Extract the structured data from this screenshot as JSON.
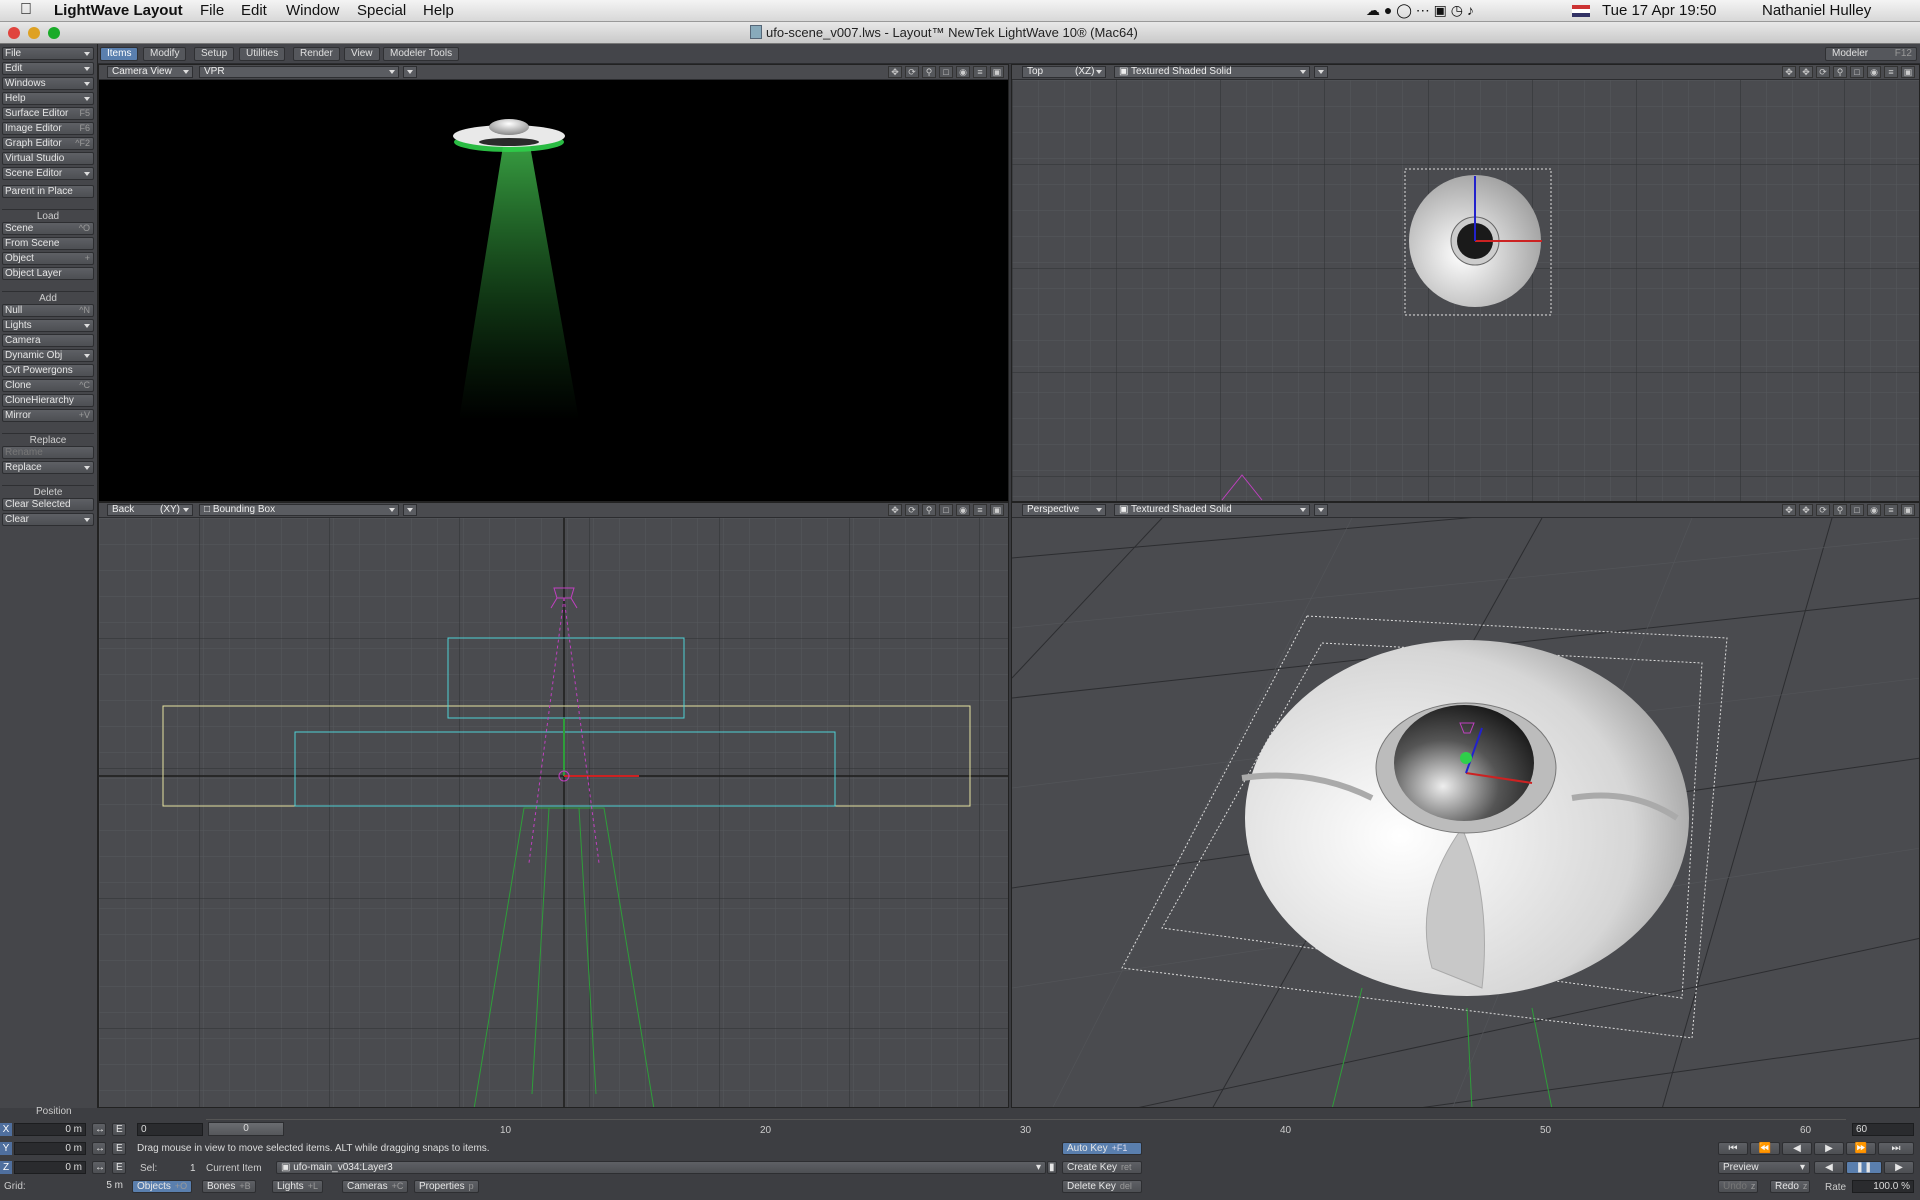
{
  "menubar": {
    "app_name": "LightWave Layout",
    "menus": [
      "File",
      "Edit",
      "Window",
      "Special",
      "Help"
    ],
    "clock": "Tue 17 Apr  19:50",
    "user": "Nathaniel Hulley"
  },
  "window": {
    "title": "ufo-scene_v007.lws - Layout™ NewTek LightWave 10® (Mac64)"
  },
  "tabs": [
    "Items",
    "Modify",
    "Setup",
    "Utilities",
    "Render",
    "View",
    "Modeler Tools"
  ],
  "modeler_button": {
    "label": "Modeler",
    "shortcut": "F12"
  },
  "left_panel": {
    "top_menus": [
      "File",
      "Edit",
      "Windows",
      "Help"
    ],
    "editors": [
      {
        "label": "Surface Editor",
        "shortcut": "F5"
      },
      {
        "label": "Image Editor",
        "shortcut": "F6"
      },
      {
        "label": "Graph Editor",
        "shortcut": "^F2"
      },
      {
        "label": "Virtual Studio",
        "shortcut": ""
      },
      {
        "label": "Scene Editor",
        "shortcut": ""
      }
    ],
    "parent_in_place": "Parent in Place",
    "load_header": "Load",
    "load_items": [
      {
        "label": "Scene",
        "shortcut": "^O"
      },
      {
        "label": "From Scene",
        "shortcut": ""
      },
      {
        "label": "Object",
        "shortcut": "+"
      },
      {
        "label": "Object Layer",
        "shortcut": ""
      }
    ],
    "add_header": "Add",
    "add_items": [
      {
        "label": "Null",
        "shortcut": "^N"
      },
      {
        "label": "Lights",
        "shortcut": ""
      },
      {
        "label": "Camera",
        "shortcut": ""
      },
      {
        "label": "Dynamic Obj",
        "shortcut": ""
      },
      {
        "label": "Cvt Powergons",
        "shortcut": ""
      },
      {
        "label": "Clone",
        "shortcut": "^C"
      },
      {
        "label": "CloneHierarchy",
        "shortcut": ""
      },
      {
        "label": "Mirror",
        "shortcut": "+V"
      }
    ],
    "replace_header": "Replace",
    "rename": "Rename",
    "replace": "Replace",
    "delete_header": "Delete",
    "clear_selected": "Clear Selected",
    "clear": "Clear"
  },
  "viewports": {
    "tl": {
      "view": "Camera View",
      "mode": "VPR"
    },
    "tr": {
      "view": "Top",
      "axis": "(XZ)",
      "mode": "Textured Shaded Solid"
    },
    "bl": {
      "view": "Back",
      "axis": "(XY)",
      "mode": "Bounding Box"
    },
    "br": {
      "view": "Perspective",
      "mode": "Textured Shaded Solid"
    }
  },
  "bottom": {
    "position_label": "Position",
    "x_label": "X",
    "x_value": "0 m",
    "y_label": "Y",
    "y_value": "0 m",
    "z_label": "Z",
    "z_value": "0 m",
    "grid_label": "Grid:",
    "grid_value": "5 m",
    "frame_field": "0",
    "slider_value": "0",
    "timeline_ticks": [
      "10",
      "20",
      "30",
      "40",
      "50",
      "60"
    ],
    "end_frame": "60",
    "status_message": "Drag mouse in view to move selected items. ALT while dragging snaps to items.",
    "sel_label": "Sel:",
    "sel_value": "1",
    "current_item_label": "Current Item",
    "current_item": "ufo-main_v034:Layer3",
    "objects": "Objects",
    "objects_sc": "+O",
    "bones": "Bones",
    "bones_sc": "+B",
    "lights": "Lights",
    "lights_sc": "+L",
    "cameras": "Cameras",
    "cameras_sc": "+C",
    "properties": "Properties",
    "properties_sc": "p",
    "auto_key": "Auto Key",
    "auto_key_sc": "+F1",
    "create_key": "Create Key",
    "create_key_sc": "ret",
    "delete_key": "Delete Key",
    "delete_key_sc": "del",
    "preview": "Preview",
    "undo": "Undo",
    "undo_sc": "z",
    "redo": "Redo",
    "redo_sc": "z",
    "rate_label": "Rate",
    "rate_value": "100.0 %"
  },
  "colors": {
    "accent": "#5a7fae",
    "beam": "#2e9e3a",
    "ufo": "#d8d8d8"
  }
}
